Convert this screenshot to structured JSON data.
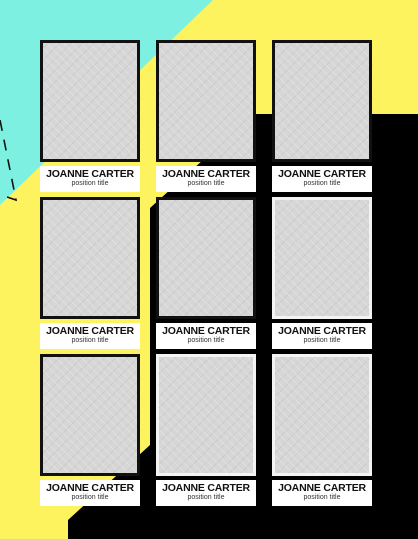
{
  "colors": {
    "cyan": "#7ef0e2",
    "yellow": "#fdf35e",
    "black": "#000000",
    "photo_fill": "#d6d6d6",
    "label_bg": "#ffffff"
  },
  "cards": [
    {
      "name": "JOANNE CARTER",
      "position": "position title",
      "frame": "dark"
    },
    {
      "name": "JOANNE CARTER",
      "position": "position title",
      "frame": "dark"
    },
    {
      "name": "JOANNE CARTER",
      "position": "position title",
      "frame": "dark"
    },
    {
      "name": "JOANNE CARTER",
      "position": "position title",
      "frame": "dark"
    },
    {
      "name": "JOANNE CARTER",
      "position": "position title",
      "frame": "dark"
    },
    {
      "name": "JOANNE CARTER",
      "position": "position title",
      "frame": "light"
    },
    {
      "name": "JOANNE CARTER",
      "position": "position title",
      "frame": "dark"
    },
    {
      "name": "JOANNE CARTER",
      "position": "position title",
      "frame": "light"
    },
    {
      "name": "JOANNE CARTER",
      "position": "position title",
      "frame": "light"
    }
  ]
}
